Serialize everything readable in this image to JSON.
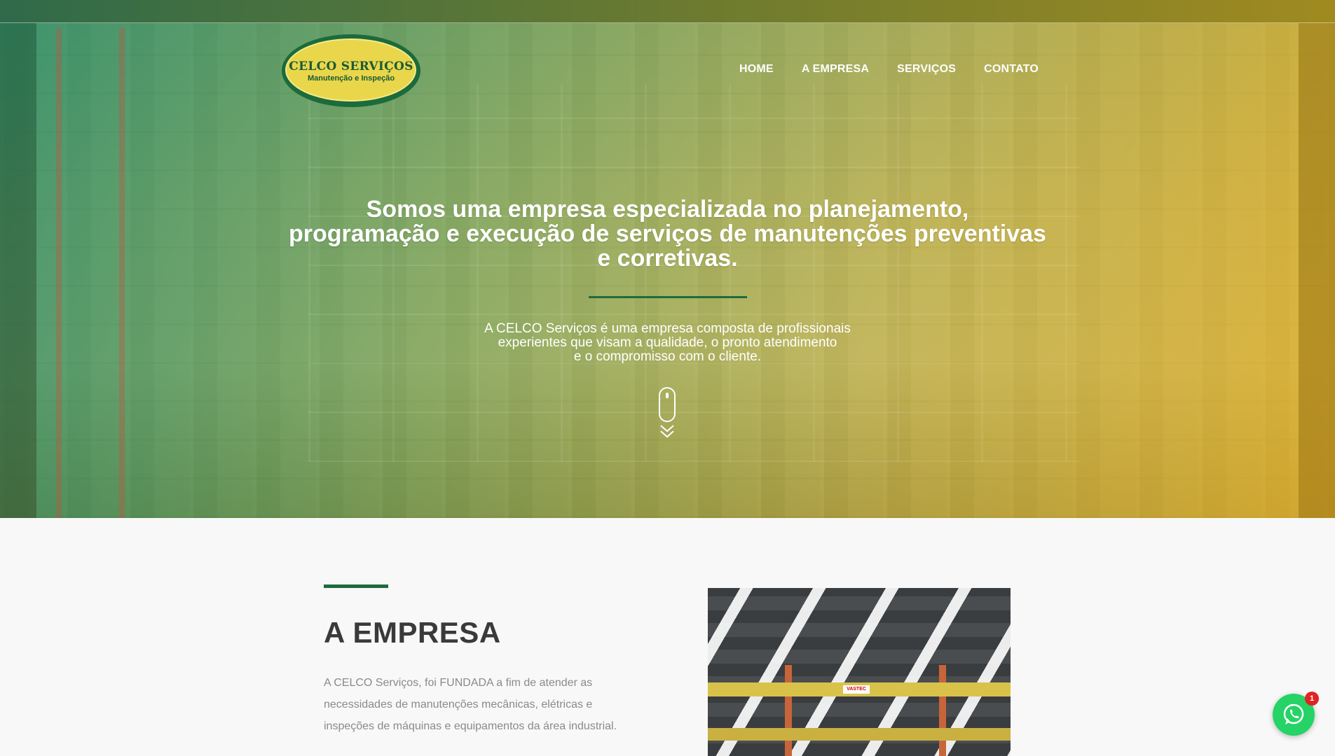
{
  "logo": {
    "title": "CELCO SERVIÇOS",
    "subtitle": "Manutenção e Inspeção"
  },
  "nav": {
    "items": [
      {
        "label": "HOME"
      },
      {
        "label": "A EMPRESA"
      },
      {
        "label": "SERVIÇOS"
      },
      {
        "label": "CONTATO"
      }
    ]
  },
  "hero": {
    "title_lines": [
      "Somos uma empresa especializada no planejamento,",
      "programação e execução de serviços de manutenções preventivas",
      "e corretivas."
    ],
    "subtitle_lines": [
      "A CELCO Serviços é uma empresa composta de profissionais",
      "experientes que visam a qualidade, o pronto atendimento",
      "e o compromisso com o cliente."
    ]
  },
  "about": {
    "title": "A EMPRESA",
    "text_lines": [
      "A CELCO Serviços, foi FUNDADA a fim de atender as",
      "necessidades de manutenções mecânicas, elétricas e",
      "inspeções de máquinas e equipamentos da área industrial."
    ],
    "photo_label": "VASTEC"
  },
  "whatsapp": {
    "badge_count": "1"
  },
  "colors": {
    "brand_green": "#1d6b3d",
    "brand_yellow": "#e9d64b",
    "whatsapp_green": "#25d366",
    "badge_red": "#e02424"
  },
  "icons": {
    "scroll": "mouse-scroll-icon",
    "scroll_arrows": "chevron-down-double-icon",
    "whatsapp": "whatsapp-icon"
  }
}
